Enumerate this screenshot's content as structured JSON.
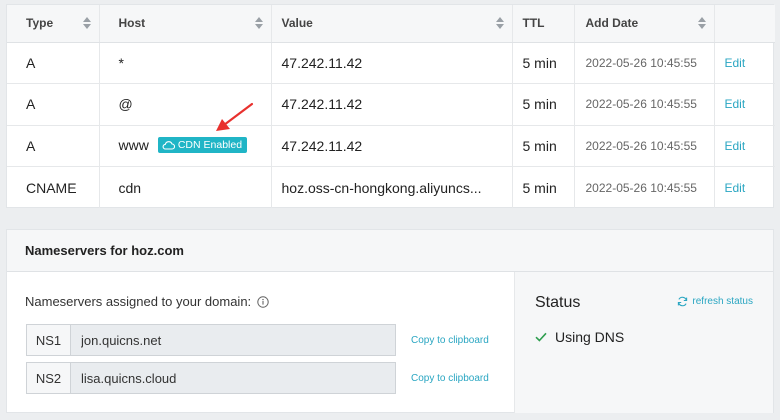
{
  "dns_table": {
    "headers": {
      "type": "Type",
      "host": "Host",
      "value": "Value",
      "ttl": "TTL",
      "add_date": "Add Date"
    },
    "rows": [
      {
        "type": "A",
        "host": "*",
        "value": "47.242.11.42",
        "ttl": "5 min",
        "add_date": "2022-05-26 10:45:55",
        "action": "Edit"
      },
      {
        "type": "A",
        "host": "@",
        "value": "47.242.11.42",
        "ttl": "5 min",
        "add_date": "2022-05-26 10:45:55",
        "action": "Edit"
      },
      {
        "type": "A",
        "host": "www",
        "badge": "CDN Enabled",
        "value": "47.242.11.42",
        "ttl": "5 min",
        "add_date": "2022-05-26 10:45:55",
        "action": "Edit"
      },
      {
        "type": "CNAME",
        "host": "cdn",
        "value": "hoz.oss-cn-hongkong.aliyuncs...",
        "ttl": "5 min",
        "add_date": "2022-05-26 10:45:55",
        "action": "Edit"
      }
    ]
  },
  "nameservers": {
    "title": "Nameservers for hoz.com",
    "assigned_label": "Nameservers assigned to your domain:",
    "entries": [
      {
        "tag": "NS1",
        "value": "jon.quicns.net",
        "copy_label": "Copy to clipboard"
      },
      {
        "tag": "NS2",
        "value": "lisa.quicns.cloud",
        "copy_label": "Copy to clipboard"
      }
    ],
    "status": {
      "title": "Status",
      "refresh_label": "refresh status",
      "value": "Using DNS"
    }
  },
  "colors": {
    "accent": "#2aa6c2",
    "badge": "#20b5c6",
    "annotation_arrow": "#e8312e",
    "status_check": "#2e9e4f"
  }
}
